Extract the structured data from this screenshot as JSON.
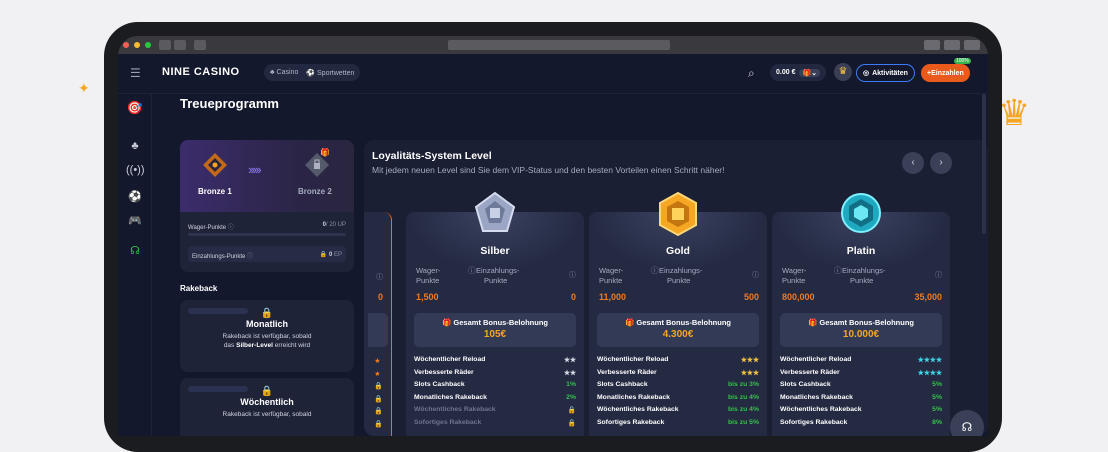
{
  "header": {
    "logo": "NINE CASINO",
    "tabs": [
      {
        "label": "Casino",
        "icon": "cherries-icon"
      },
      {
        "label": "Sportwetten",
        "icon": "soccer-ball-icon"
      }
    ],
    "balance": "0.00 €",
    "activities": "Aktivitäten",
    "deposit": "Einzahlen",
    "deposit_badge": "100%"
  },
  "page": {
    "title": "Treueprogramm"
  },
  "level_card": {
    "current_level": "Bronze 1",
    "next_level": "Bronze 2",
    "wager_label": "Wager-Punkte",
    "wager_value": "0",
    "wager_max": "/ 20 UP",
    "deposit_label": "Einzahlungs-Punkte",
    "deposit_value": "0",
    "deposit_unit": "EP"
  },
  "rakeback": {
    "title": "Rakeback",
    "items": [
      {
        "title": "Monatlich",
        "desc1": "Rakeback ist verfügbar, sobald",
        "desc2_pre": "das ",
        "desc2_level": "Silber-Level",
        "desc2_post": " erreicht wird"
      },
      {
        "title": "Wöchentlich",
        "desc1": "Rakeback ist verfügbar, sobald"
      }
    ]
  },
  "loyalty": {
    "title": "Loyalitäts-System Level",
    "subtitle": "Mit jedem neuen Level sind Sie dem VIP-Status und den besten Vorteilen einen Schritt näher!",
    "edge_value": "0",
    "wager_label_1": "Wager-",
    "wager_label_2": "Punkte",
    "deposit_label_1": "Einzahlungs-",
    "deposit_label_2": "Punkte",
    "bonus_label": "Gesamt Bonus-Belohnung",
    "levels": [
      {
        "name": "Silber",
        "wager": "1,500",
        "deposit": "0",
        "bonus": "105€",
        "perks": [
          {
            "label": "Wöchentlicher Reload",
            "value": "★★",
            "color": "#d8dbe6"
          },
          {
            "label": "Verbesserte Räder",
            "value": "★★",
            "color": "#d8dbe6"
          },
          {
            "label": "Slots Cashback",
            "value": "1%",
            "color": "#35c24a"
          },
          {
            "label": "Monatliches Rakeback",
            "value": "2%",
            "color": "#35c24a"
          },
          {
            "label": "Wöchentliches Rakeback",
            "value": "🔒",
            "color": "#8a90a6",
            "muted": true
          },
          {
            "label": "Sofortiges Rakeback",
            "value": "🔒",
            "color": "#8a90a6",
            "muted": true
          }
        ]
      },
      {
        "name": "Gold",
        "wager": "11,000",
        "deposit": "500",
        "bonus": "4.300€",
        "perks": [
          {
            "label": "Wöchentlicher Reload",
            "value": "★★★",
            "color": "#f5c542"
          },
          {
            "label": "Verbesserte Räder",
            "value": "★★★",
            "color": "#f5c542"
          },
          {
            "label": "Slots Cashback",
            "value": "bis zu 3%",
            "color": "#35c24a"
          },
          {
            "label": "Monatliches Rakeback",
            "value": "bis zu 4%",
            "color": "#35c24a"
          },
          {
            "label": "Wöchentliches Rakeback",
            "value": "bis zu 4%",
            "color": "#35c24a"
          },
          {
            "label": "Sofortiges Rakeback",
            "value": "bis zu 5%",
            "color": "#35c24a"
          }
        ]
      },
      {
        "name": "Platin",
        "wager": "800,000",
        "deposit": "35,000",
        "bonus": "10.000€",
        "perks": [
          {
            "label": "Wöchentlicher Reload",
            "value": "★★★★",
            "color": "#3fd6e8"
          },
          {
            "label": "Verbesserte Räder",
            "value": "★★★★",
            "color": "#3fd6e8"
          },
          {
            "label": "Slots Cashback",
            "value": "5%",
            "color": "#35c24a"
          },
          {
            "label": "Monatliches Rakeback",
            "value": "5%",
            "color": "#35c24a"
          },
          {
            "label": "Wöchentliches Rakeback",
            "value": "5%",
            "color": "#35c24a"
          },
          {
            "label": "Sofortiges Rakeback",
            "value": "8%",
            "color": "#35c24a"
          }
        ]
      }
    ]
  }
}
